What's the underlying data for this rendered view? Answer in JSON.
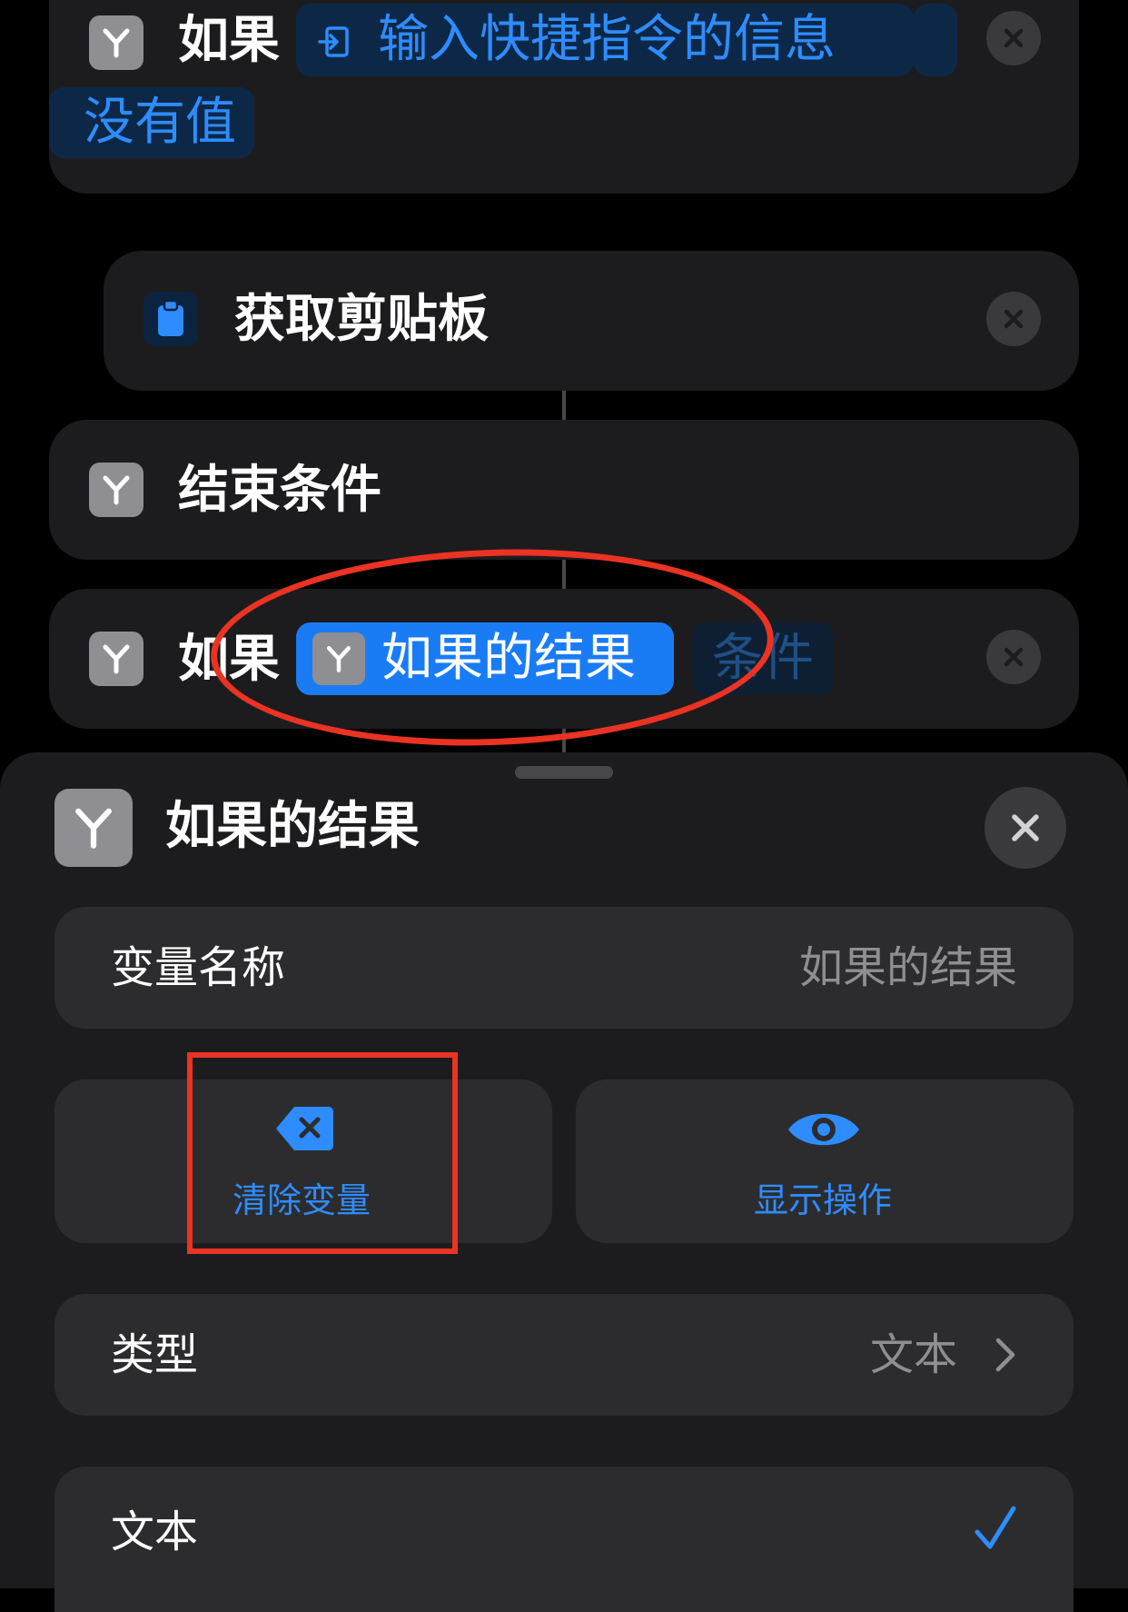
{
  "flow": {
    "if1": {
      "keyword": "如果",
      "token_label": "输入快捷指令的信息",
      "condition": "没有值"
    },
    "get_clipboard": {
      "title": "获取剪贴板"
    },
    "end_if": {
      "title": "结束条件"
    },
    "if2": {
      "keyword": "如果",
      "variable_label": "如果的结果",
      "condition_placeholder": "条件"
    }
  },
  "sheet": {
    "title": "如果的结果",
    "variable_name_label": "变量名称",
    "variable_name_value": "如果的结果",
    "clear_variable_label": "清除变量",
    "show_action_label": "显示操作",
    "type_label": "类型",
    "type_value": "文本",
    "text_option_label": "文本"
  },
  "colors": {
    "accent": "#2e8cff",
    "annotation": "#ea3323",
    "card_bg": "#1c1c1e",
    "row_bg": "#2c2c2e",
    "icon_gray": "#8e8e93"
  }
}
